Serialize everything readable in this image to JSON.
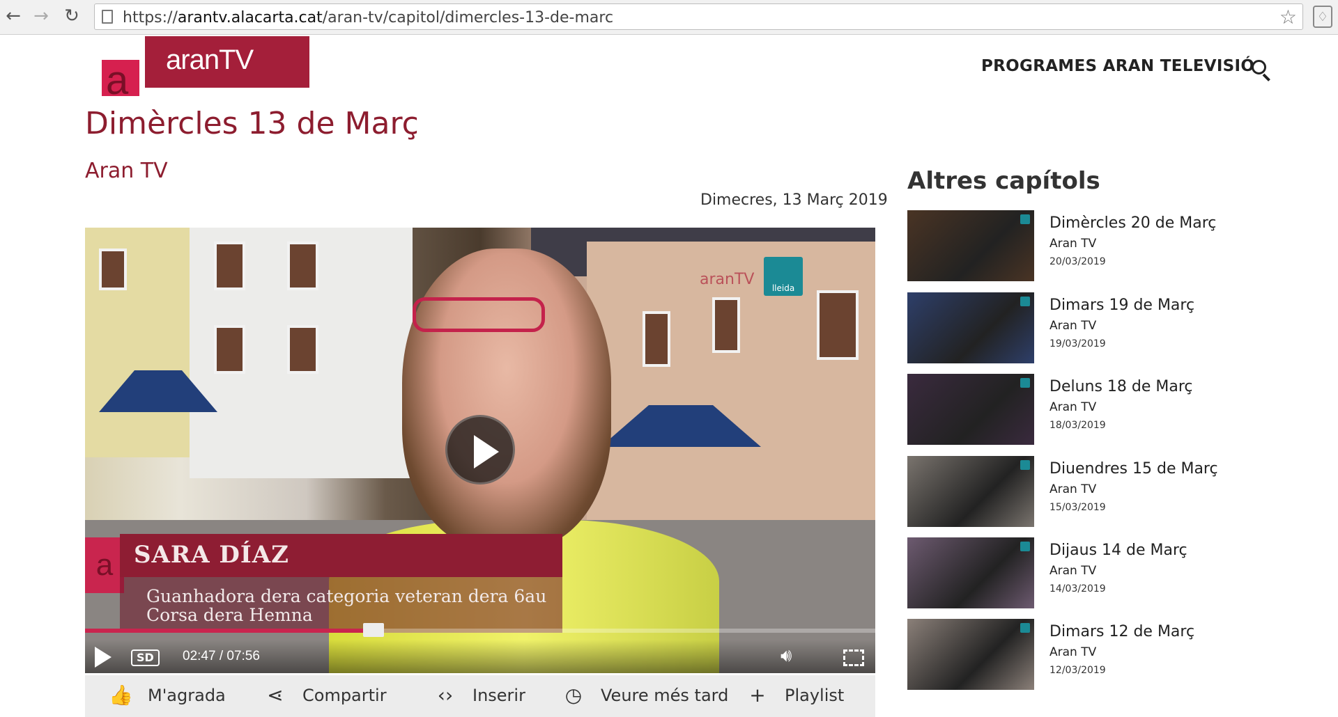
{
  "browser": {
    "url_prefix": "https://",
    "url_host": "arantv.alacarta.cat",
    "url_path": "/aran-tv/capitol/dimercles-13-de-marc",
    "icons": [
      "back-icon",
      "forward-icon",
      "reload-icon",
      "page-icon",
      "star-icon",
      "bulb-icon"
    ]
  },
  "header": {
    "logo_letter": "a",
    "logo_text": "aranTV",
    "nav_label": "PROGRAMES ARAN TELEVISIÓ",
    "search_icon": "search-icon"
  },
  "episode": {
    "title": "Dimèrcles 13 de Març",
    "channel": "Aran TV",
    "date": "Dimecres, 13 Març 2019"
  },
  "video": {
    "watermark_aran": "aranTV",
    "watermark_lleida": "lleida",
    "lower_third_letter": "a",
    "lower_third_name": "SARA DÍAZ",
    "lower_third_desc": "Guanhadora dera categoria veteran dera 6au Corsa dera Hemna",
    "quality": "SD",
    "time": "02:47 / 07:56",
    "progress_fraction": 0.365,
    "accent_color": "#c9254e"
  },
  "actions": [
    {
      "label": "M'agrada",
      "icon": "thumbs-up-icon",
      "glyph": "👍"
    },
    {
      "label": "Compartir",
      "icon": "share-icon",
      "glyph": "⋖"
    },
    {
      "label": "Inserir",
      "icon": "embed-icon",
      "glyph": "‹›"
    },
    {
      "label": "Veure més tard",
      "icon": "clock-icon",
      "glyph": "◷"
    },
    {
      "label": "Playlist",
      "icon": "plus-icon",
      "glyph": "+"
    }
  ],
  "sidebar": {
    "title": "Altres capítols",
    "episodes": [
      {
        "name": "Dimèrcles 20 de Març",
        "channel": "Aran TV",
        "date": "20/03/2019",
        "thumb_color": "#4a3424"
      },
      {
        "name": "Dimars 19 de Març",
        "channel": "Aran TV",
        "date": "19/03/2019",
        "thumb_color": "#2e3f6a"
      },
      {
        "name": "Deluns 18 de Març",
        "channel": "Aran TV",
        "date": "18/03/2019",
        "thumb_color": "#3a2a3e"
      },
      {
        "name": "Diuendres 15 de Març",
        "channel": "Aran TV",
        "date": "15/03/2019",
        "thumb_color": "#7a746e"
      },
      {
        "name": "Dijaus 14 de Març",
        "channel": "Aran TV",
        "date": "14/03/2019",
        "thumb_color": "#6d5a70"
      },
      {
        "name": "Dimars 12 de Març",
        "channel": "Aran TV",
        "date": "12/03/2019",
        "thumb_color": "#8b8079"
      }
    ]
  }
}
